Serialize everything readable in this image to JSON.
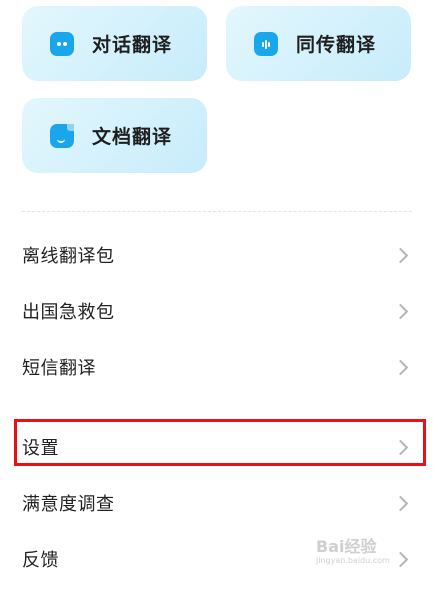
{
  "features": {
    "dialog_translate": "对话翻译",
    "simultaneous_translate": "同传翻译",
    "document_translate": "文档翻译"
  },
  "menu": {
    "items": [
      {
        "label": "离线翻译包"
      },
      {
        "label": "出国急救包"
      },
      {
        "label": "短信翻译"
      },
      {
        "label": "设置"
      },
      {
        "label": "满意度调查"
      },
      {
        "label": "反馈"
      }
    ]
  },
  "watermark": {
    "brand": "Bai经验",
    "url": "jingyan.baidu.com"
  },
  "colors": {
    "card_bg": "#d4f1fc",
    "icon_blue": "#1aa6ea",
    "highlight": "#e8111a"
  }
}
